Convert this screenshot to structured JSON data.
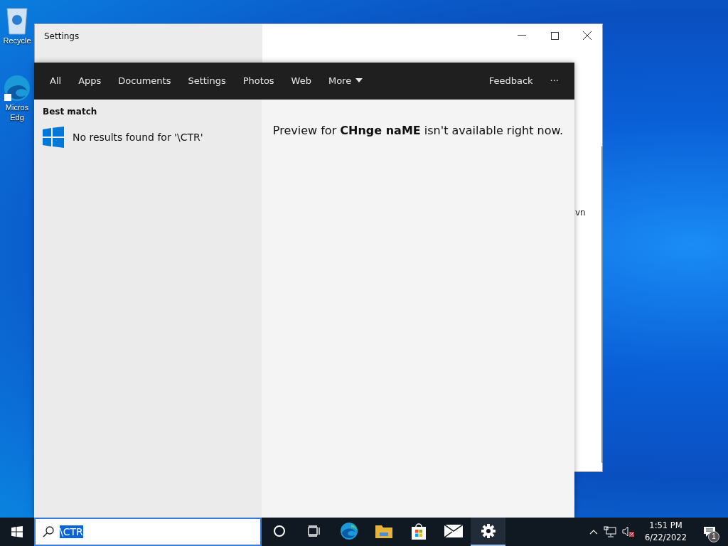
{
  "desktop_icons": [
    {
      "kind": "recycle",
      "lines": [
        "Recycle"
      ]
    },
    {
      "kind": "edge",
      "lines": [
        "Micros",
        "Edg"
      ]
    }
  ],
  "settings_window": {
    "title": "Settings",
    "clipped_text": "vn"
  },
  "search_panel": {
    "tabs": [
      {
        "label": "All",
        "kind": "plain"
      },
      {
        "label": "Apps",
        "kind": "plain"
      },
      {
        "label": "Documents",
        "kind": "plain"
      },
      {
        "label": "Settings",
        "kind": "plain"
      },
      {
        "label": "Photos",
        "kind": "plain"
      },
      {
        "label": "Web",
        "kind": "plain"
      },
      {
        "label": "More",
        "kind": "dropdown"
      }
    ],
    "feedback": "Feedback",
    "more_options": "···",
    "section_heading": "Best match",
    "result": "No results found for '\\CTR'",
    "preview": "Preview for **CHnge naME** isn't available right now."
  },
  "taskbar": {
    "search_value": "\\CTR",
    "apps": [
      {
        "kind": "cortana",
        "active": false
      },
      {
        "kind": "taskview",
        "active": false
      },
      {
        "kind": "edge",
        "active": false
      },
      {
        "kind": "explorer",
        "active": false
      },
      {
        "kind": "store",
        "active": false
      },
      {
        "kind": "mail",
        "active": false
      },
      {
        "kind": "settings",
        "active": true
      }
    ],
    "time": "1:51 PM",
    "date": "6/22/2022",
    "notification_count": "1"
  }
}
